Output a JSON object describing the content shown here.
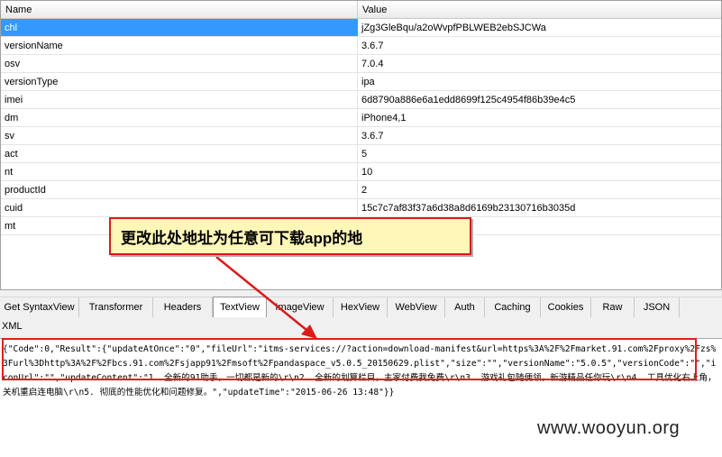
{
  "grid": {
    "header": {
      "name": "Name",
      "value": "Value"
    },
    "rows": [
      {
        "name": "chl",
        "value": "jZg3GleBqu/a2oWvpfPBLWEB2ebSJCWa",
        "selected": true
      },
      {
        "name": "versionName",
        "value": "3.6.7"
      },
      {
        "name": "osv",
        "value": "7.0.4"
      },
      {
        "name": "versionType",
        "value": "ipa"
      },
      {
        "name": "imei",
        "value": "6d8790a886e6a1edd8699f125c4954f86b39e4c5"
      },
      {
        "name": "dm",
        "value": "iPhone4,1"
      },
      {
        "name": "sv",
        "value": "3.6.7"
      },
      {
        "name": "act",
        "value": "5"
      },
      {
        "name": "nt",
        "value": "10"
      },
      {
        "name": "productId",
        "value": "2"
      },
      {
        "name": "cuid",
        "value": "15c7c7af83f37a6d38a8d6169b23130716b3035d"
      },
      {
        "name": "mt",
        "value": ""
      }
    ]
  },
  "tabs": {
    "row1": [
      "Get SyntaxView",
      "Transformer",
      "Headers",
      "TextView",
      "ImageView",
      "HexView",
      "WebView",
      "Auth",
      "Caching",
      "Cookies",
      "Raw",
      "JSON"
    ],
    "active": "TextView",
    "row2": "XML"
  },
  "response_text": "{\"Code\":0,\"Result\":{\"updateAtOnce\":\"0\",\"fileUrl\":\"itms-services://?action=download-manifest&url=https%3A%2F%2Fmarket.91.com%2Fproxy%2Fzs%3Furl%3Dhttp%3A%2F%2Fbcs.91.com%2Fsjapp91%2Fmsoft%2Fpandaspace_v5.0.5_20150629.plist\",\"size\":\"\",\"versionName\":\"5.0.5\",\"versionCode\":\"\",\"iconUrl\":\"\",\"updateContent\":\"1. 全新的91助手，一切都是新的\\r\\n2. 全新的划算栏目，主家付费我免费\\r\\n3. 游戏礼包随便领，新游精品任你玩\\r\\n4. 工具优化右上角，关机重启连电脑\\r\\n5. 彻底的性能优化和问题修复。\",\"updateTime\":\"2015-06-26 13:48\"}}",
  "callout": {
    "text": "更改此处地址为任意可下载app的地"
  },
  "watermark": "www.wooyun.org",
  "colors": {
    "selection": "#3399ff",
    "annotation_red": "#d81b1b",
    "callout_bg": "#fff7b8"
  }
}
